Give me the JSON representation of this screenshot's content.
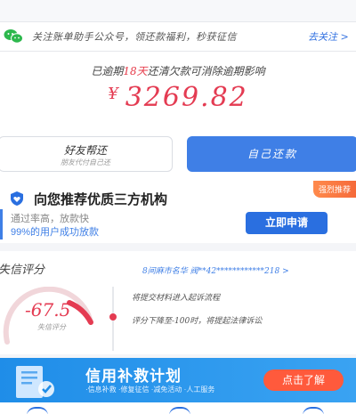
{
  "notice": {
    "text": "关注账单助手公众号，领还款福利，秒获征信",
    "follow_label": "去关注 >"
  },
  "amount": {
    "tip_prefix": "已逾期",
    "tip_days": "18天",
    "tip_suffix": "还清欠款可消除逾期影响",
    "currency": "¥",
    "value": "3269.82"
  },
  "friend_help": {
    "label": "好友帮还",
    "sub": "朋友代付自己还"
  },
  "self_repay": {
    "label": "自己还款"
  },
  "recommend": {
    "badge": "强烈推荐",
    "title": "向您推荐优质三方机构",
    "sub": "通过率高，放款快",
    "rate": "99%的用户成功放款",
    "apply_label": "立即申请"
  },
  "credit": {
    "title": "失信评分",
    "loan_info": "8间麻市名华 阀**42************218 >",
    "score": "-67.5",
    "score_label": "失信评分",
    "step1": "将提交材料进入起诉流程",
    "step2": "评分下降至-100时，将提起法律诉讼"
  },
  "banner": {
    "title": "信用补救计划",
    "sub": "·信息补救 ·修复征信 ·减免活动 ·人工服务",
    "button": "点击了解"
  },
  "colors": {
    "accent": "#3f7fe6",
    "danger": "#e43b52",
    "banner": "#1f8de8",
    "cta": "#ff5a3c"
  }
}
